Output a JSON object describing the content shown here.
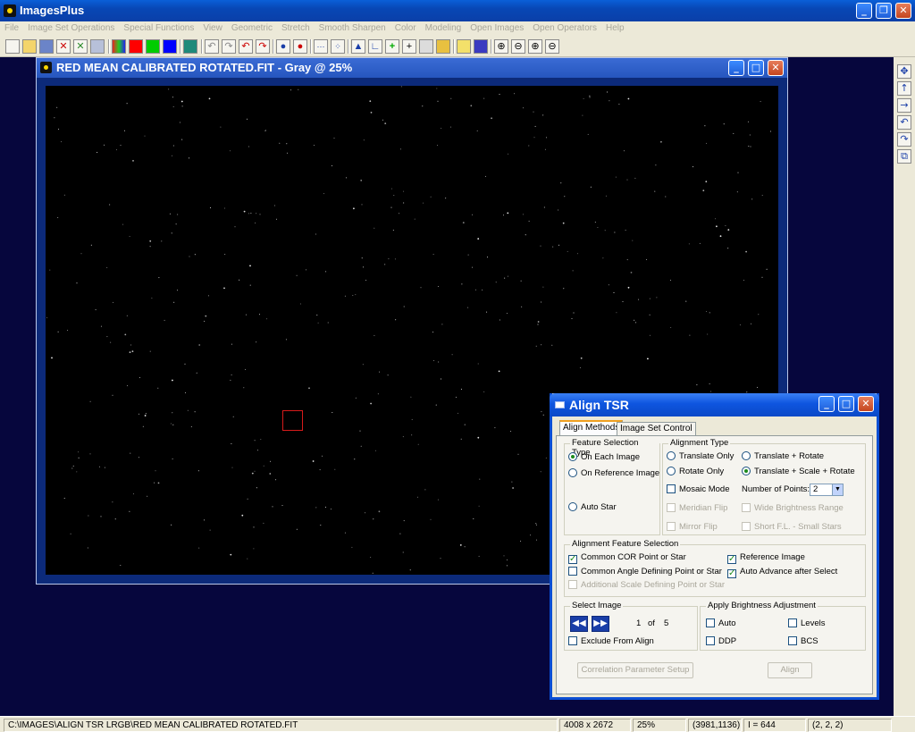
{
  "app": {
    "title": "ImagesPlus"
  },
  "menu": [
    "File",
    "Image Set Operations",
    "Special Functions",
    "View",
    "Geometric",
    "Stretch",
    "Smooth Sharpen",
    "Color",
    "Modeling",
    "Open Images",
    "Open Operators",
    "Help"
  ],
  "image_window": {
    "title": "RED MEAN CALIBRATED ROTATED.FIT - Gray @ 25%"
  },
  "dialog": {
    "title": "Align TSR",
    "tabs": [
      "Align Methods",
      "Image Set Control"
    ],
    "feature_selection": {
      "label": "Feature Selection Type",
      "on_each_image": "On Each Image",
      "on_reference_image": "On Reference Image",
      "auto_star": "Auto Star"
    },
    "alignment_type": {
      "label": "Alignment Type",
      "translate_only": "Translate Only",
      "translate_rotate": "Translate + Rotate",
      "rotate_only": "Rotate Only",
      "translate_scale_rotate": "Translate + Scale + Rotate",
      "mosaic_mode": "Mosaic Mode",
      "number_of_points_label": "Number of Points:",
      "number_of_points": "2",
      "meridian_flip": "Meridian Flip",
      "wide_brightness_range": "Wide Brightness Range",
      "mirror_flip": "Mirror Flip",
      "short_fl": "Short F.L. - Small Stars"
    },
    "alignment_feature": {
      "label": "Alignment Feature Selection",
      "common_cor": "Common COR Point or Star",
      "reference_image": "Reference Image",
      "common_angle": "Common Angle Defining Point or Star",
      "auto_advance": "Auto Advance after Select",
      "additional_scale": "Additional Scale Defining Point or Star"
    },
    "select_image": {
      "label": "Select Image",
      "current": "1",
      "of": "of",
      "total": "5",
      "exclude": "Exclude From Align"
    },
    "brightness": {
      "label": "Apply Brightness Adjustment",
      "auto": "Auto",
      "levels": "Levels",
      "ddp": "DDP",
      "bcs": "BCS"
    },
    "correlation_button": "Correlation Parameter Setup",
    "align_button": "Align"
  },
  "status": {
    "path": "C:\\IMAGES\\ALIGN TSR LRGB\\RED MEAN CALIBRATED ROTATED.FIT",
    "dimensions": "4008 x 2672",
    "zoom": "25%",
    "coords": "(3981,1136)",
    "intensity": "I = 644",
    "pixel": "(2, 2, 2)"
  },
  "colors": {
    "workspace": "#06063d",
    "accent": "#0b4fd4"
  }
}
